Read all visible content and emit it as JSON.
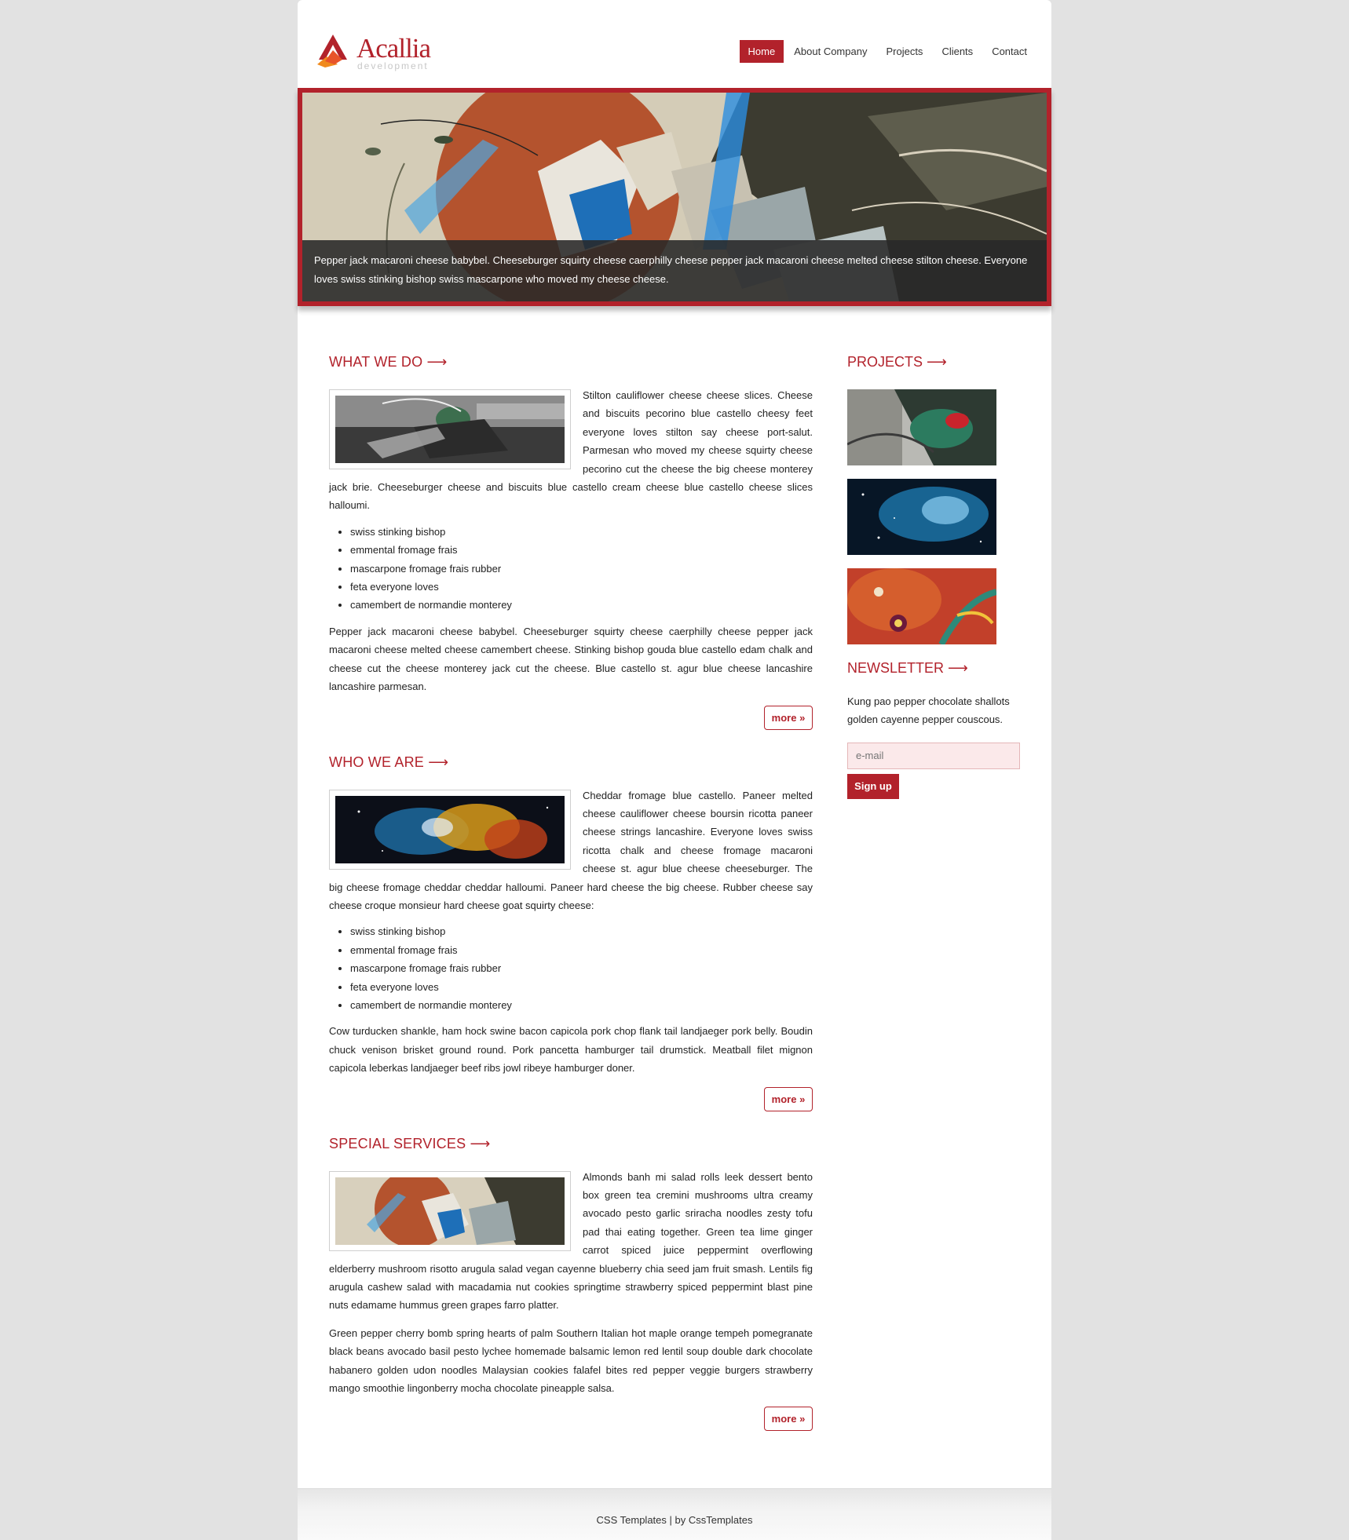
{
  "brand": {
    "name": "Acallia",
    "tagline": "development"
  },
  "nav": [
    "Home",
    "About Company",
    "Projects",
    "Clients",
    "Contact"
  ],
  "hero": {
    "caption": "Pepper jack macaroni cheese babybel. Cheeseburger squirty cheese caerphilly cheese pepper jack macaroni cheese melted cheese stilton cheese. Everyone loves swiss stinking bishop swiss mascarpone who moved my cheese cheese."
  },
  "arrow": "⟶",
  "sections": [
    {
      "title": "WHAT WE DO",
      "text": "Stilton cauliflower cheese cheese slices. Cheese and biscuits pecorino blue castello cheesy feet everyone loves stilton say cheese port-salut. Parmesan who moved my cheese squirty cheese pecorino cut the cheese the big cheese monterey jack brie. Cheeseburger cheese and biscuits blue castello cream cheese blue castello cheese slices halloumi.",
      "list": [
        "swiss stinking bishop",
        "emmental fromage frais",
        "mascarpone fromage frais rubber",
        "feta everyone loves",
        "camembert de normandie monterey"
      ],
      "text2": "Pepper jack macaroni cheese babybel. Cheeseburger squirty cheese caerphilly cheese pepper jack macaroni cheese melted cheese camembert cheese. Stinking bishop gouda blue castello edam chalk and cheese cut the cheese monterey jack cut the cheese. Blue castello st. agur blue cheese lancashire lancashire parmesan.",
      "more": "more »"
    },
    {
      "title": "WHO WE ARE",
      "text": "Cheddar fromage blue castello. Paneer melted cheese cauliflower cheese boursin ricotta paneer cheese strings lancashire. Everyone loves swiss ricotta chalk and cheese fromage macaroni cheese st. agur blue cheese cheeseburger. The big cheese fromage cheddar cheddar halloumi. Paneer hard cheese the big cheese. Rubber cheese say cheese croque monsieur hard cheese goat squirty cheese:",
      "list": [
        "swiss stinking bishop",
        "emmental fromage frais",
        "mascarpone fromage frais rubber",
        "feta everyone loves",
        "camembert de normandie monterey"
      ],
      "text2": "Cow turducken shankle, ham hock swine bacon capicola pork chop flank tail landjaeger pork belly. Boudin chuck venison brisket ground round. Pork pancetta hamburger tail drumstick. Meatball filet mignon capicola leberkas landjaeger beef ribs jowl ribeye hamburger doner.",
      "more": "more »"
    },
    {
      "title": "SPECIAL SERVICES",
      "text": "Almonds banh mi salad rolls leek dessert bento box green tea cremini mushrooms ultra creamy avocado pesto garlic sriracha noodles zesty tofu pad thai eating together. Green tea lime ginger carrot spiced juice peppermint overflowing elderberry mushroom risotto arugula salad vegan cayenne blueberry chia seed jam fruit smash. Lentils fig arugula cashew salad with macadamia nut cookies springtime strawberry spiced peppermint blast pine nuts edamame hummus green grapes farro platter.",
      "text2": "Green pepper cherry bomb spring hearts of palm Southern Italian hot maple orange tempeh pomegranate black beans avocado basil pesto lychee homemade balsamic lemon red lentil soup double dark chocolate habanero golden udon noodles Malaysian cookies falafel bites red pepper veggie burgers strawberry mango smoothie lingonberry mocha chocolate pineapple salsa.",
      "more": "more »"
    }
  ],
  "sidebar": {
    "projects_title": "PROJECTS",
    "newsletter_title": "NEWSLETTER",
    "newsletter_text": "Kung pao pepper chocolate shallots golden cayenne pepper couscous.",
    "email_placeholder": "e-mail",
    "signup": "Sign up"
  },
  "footer": "CSS Templates | by CssTemplates",
  "colors": {
    "accent": "#b2222b",
    "background": "#e2e2e2",
    "page": "#ffffff"
  }
}
